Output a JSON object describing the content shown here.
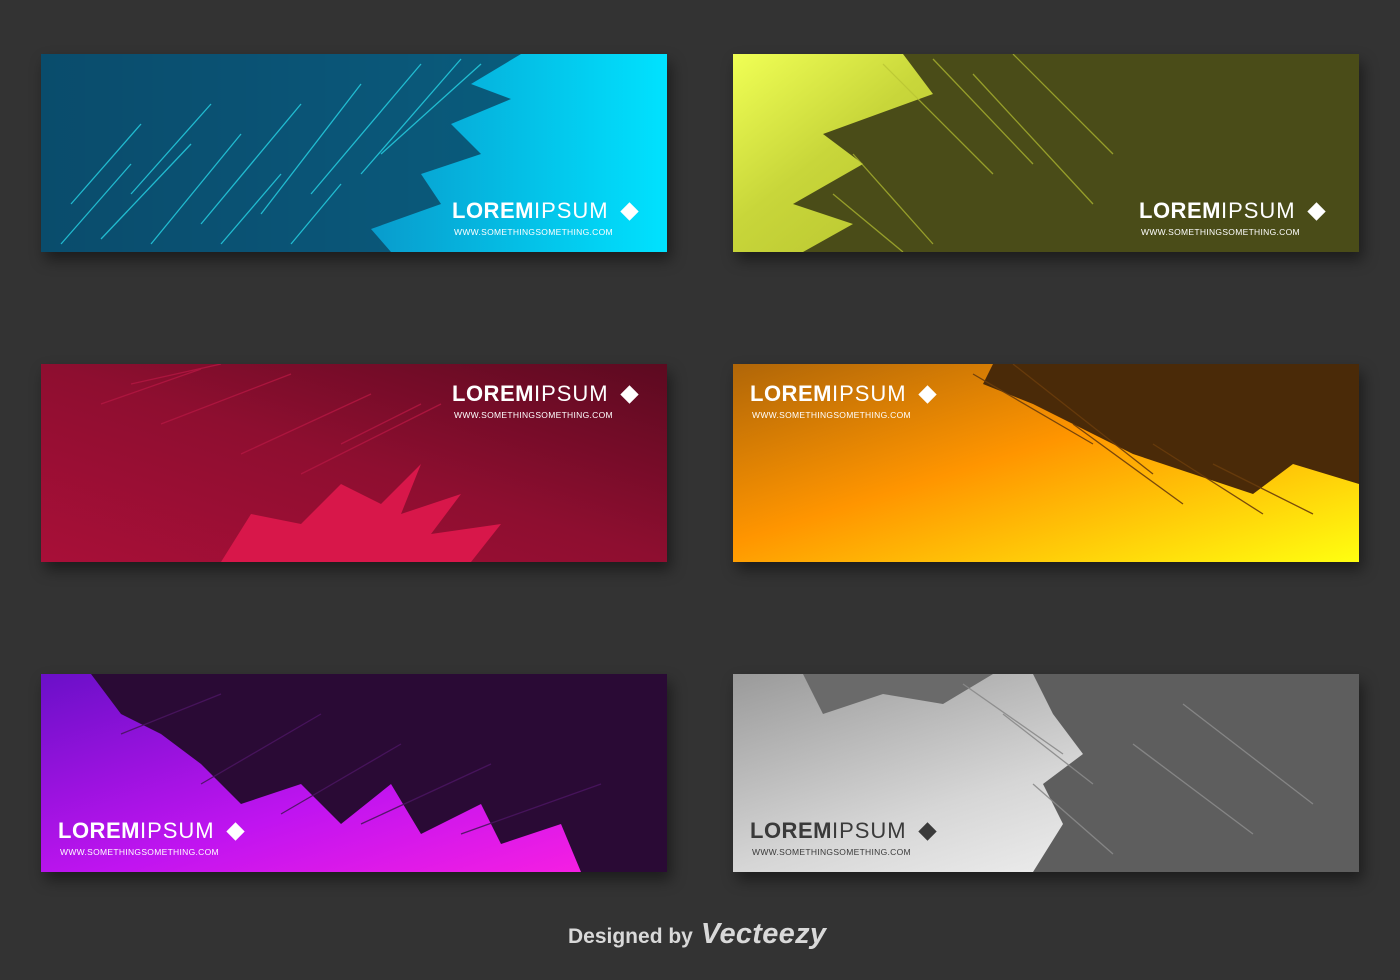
{
  "banners": [
    {
      "name": "cyan",
      "brand_bold": "LOREM",
      "brand_light": "IPSUM",
      "url": "WWW.SOMETHINGSOMETHING.COM",
      "colors": [
        "#0a4a68",
        "#00e0ff"
      ]
    },
    {
      "name": "olive",
      "brand_bold": "LOREM",
      "brand_light": "IPSUM",
      "url": "WWW.SOMETHINGSOMETHING.COM",
      "colors": [
        "#f2ff57",
        "#4a4c18"
      ]
    },
    {
      "name": "red",
      "brand_bold": "LOREM",
      "brand_light": "IPSUM",
      "url": "WWW.SOMETHINGSOMETHING.COM",
      "colors": [
        "#e0184a",
        "#5c0a20"
      ]
    },
    {
      "name": "orange",
      "brand_bold": "LOREM",
      "brand_light": "IPSUM",
      "url": "WWW.SOMETHINGSOMETHING.COM",
      "colors": [
        "#ffff1a",
        "#4a2a08"
      ]
    },
    {
      "name": "purple",
      "brand_bold": "LOREM",
      "brand_light": "IPSUM",
      "url": "WWW.SOMETHINGSOMETHING.COM",
      "colors": [
        "#ff10ff",
        "#2a0a35"
      ]
    },
    {
      "name": "gray",
      "brand_bold": "LOREM",
      "brand_light": "IPSUM",
      "url": "WWW.SOMETHINGSOMETHING.COM",
      "colors": [
        "#f0f0f0",
        "#5a5a5a"
      ]
    }
  ],
  "credit": {
    "designed_by": "Designed by",
    "brand": "Vecteezy"
  }
}
